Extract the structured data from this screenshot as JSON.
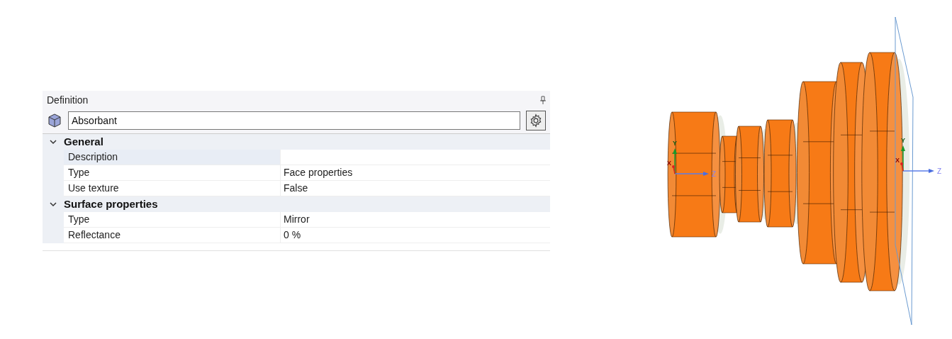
{
  "panel": {
    "title": "Definition"
  },
  "name_field": {
    "value": "Absorbant"
  },
  "categories": [
    {
      "title": "General",
      "expanded": true,
      "properties": [
        {
          "name": "Description",
          "selected": true
        },
        {
          "name": "Type",
          "value": "Face properties",
          "selected": false
        },
        {
          "name": "Use texture",
          "value": "False",
          "selected": false
        }
      ]
    },
    {
      "title": "Surface properties",
      "expanded": true,
      "properties": [
        {
          "name": "Type",
          "value": "Mirror",
          "selected": false
        },
        {
          "name": "Reflectance",
          "value": "0 %",
          "selected": false
        }
      ]
    }
  ],
  "viewport": {
    "triads": [
      {
        "y": "Y",
        "x": "X",
        "z": "Z"
      },
      {
        "y": "Y",
        "x": "X",
        "z": "Z"
      }
    ]
  }
}
